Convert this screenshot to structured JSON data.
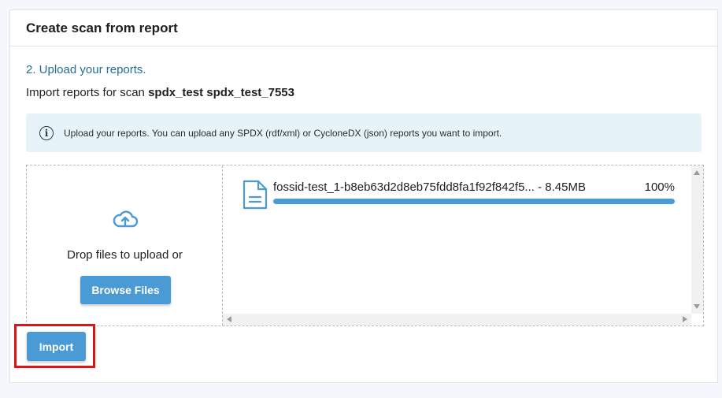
{
  "panel": {
    "title": "Create scan from report"
  },
  "step": {
    "title": "2. Upload your reports.",
    "import_prefix": "Import reports for scan ",
    "scan_name": "spdx_test spdx_test_7553"
  },
  "info": {
    "icon": "info-icon",
    "text": "Upload your reports. You can upload any SPDX (rdf/xml) or CycloneDX (json) reports you want to import."
  },
  "dropzone": {
    "icon": "cloud-upload-icon",
    "drop_text": "Drop files to upload or",
    "browse_label": "Browse Files"
  },
  "files": [
    {
      "icon": "file-document-icon",
      "name": "fossid-test_1-b8eb63d2d8eb75fdd8fa1f92f842f5... - 8.45MB",
      "percent_label": "100%",
      "progress": 1.0
    }
  ],
  "actions": {
    "import_label": "Import"
  },
  "colors": {
    "accent": "#4a9ad6",
    "step_title": "#1f6f94",
    "info_bg": "#e6f4fa",
    "highlight": "#d9141c"
  }
}
